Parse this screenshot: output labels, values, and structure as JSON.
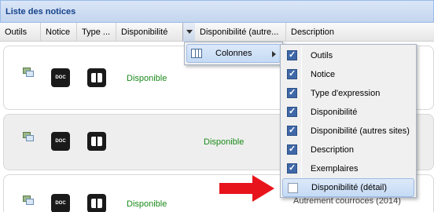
{
  "panel": {
    "title": "Liste des notices"
  },
  "columns": [
    "Outils",
    "Notice",
    "Type ...",
    "Disponibilité",
    "Disponibilité (autre...",
    "Description"
  ],
  "rows": [
    {
      "doc_label": "DOC",
      "disponibilite": "Disponible"
    },
    {
      "doc_label": "DOC",
      "disponibilite": "Disponible"
    },
    {
      "doc_label": "DOC",
      "disponibilite": "Disponible"
    }
  ],
  "partial_text": "Autrement courroces (2014)",
  "column_menu": {
    "label": "Colonnes"
  },
  "column_options": [
    {
      "label": "Outils",
      "checked": true
    },
    {
      "label": "Notice",
      "checked": true
    },
    {
      "label": "Type d'expression",
      "checked": true
    },
    {
      "label": "Disponibilité",
      "checked": true
    },
    {
      "label": "Disponibilité (autres sites)",
      "checked": true
    },
    {
      "label": "Description",
      "checked": true
    },
    {
      "label": "Exemplaires",
      "checked": true
    },
    {
      "label": "Disponibilité (détail)",
      "checked": false
    }
  ],
  "colors": {
    "header_text": "#15428b",
    "available": "#1a8a1a",
    "arrow": "#e8141c",
    "checked": "#3f68a8"
  },
  "icons": [
    "tools-icon",
    "doc-icon",
    "book-icon",
    "columns-icon",
    "submenu-arrow-icon",
    "red-arrow-icon"
  ]
}
